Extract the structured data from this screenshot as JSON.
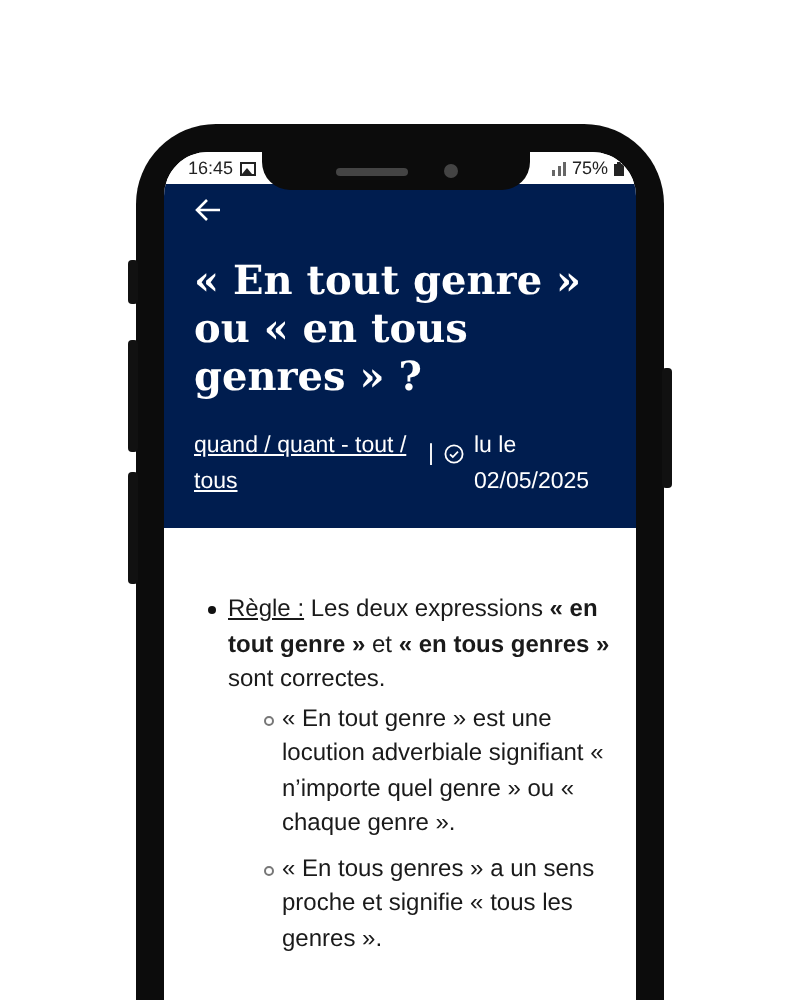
{
  "status_bar": {
    "time": "16:45",
    "battery": "75%"
  },
  "header": {
    "title": "« En tout genre » ou « en tous genres » ?",
    "category_link": "quand / quant - tout / tous",
    "separator": "|",
    "read_date": "lu le 02/05/2025"
  },
  "content": {
    "items": [
      {
        "label": "Règle :",
        "text": "Les deux expressions **« en tout genre »** et **« en tous genres »** sont correctes.",
        "children": [
          {
            "text": "« En tout genre » est une locution adverbiale signifiant « n’importe quel genre » ou « chaque genre »."
          },
          {
            "text": "« En tous genres » a un sens proche et signifie « tous les genres »."
          }
        ]
      }
    ]
  }
}
